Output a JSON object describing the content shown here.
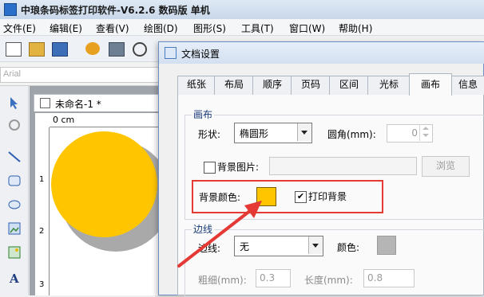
{
  "app": {
    "title": "中琅条码标签打印软件-V6.2.6 数码版 单机",
    "menu": [
      "文件(E)",
      "编辑(E)",
      "查看(V)",
      "绘图(D)",
      "图形(S)",
      "工具(T)",
      "窗口(W)",
      "帮助(H)"
    ],
    "font_name": "Arial",
    "document_tab": "未命名-1 *",
    "ruler_label": "0 cm",
    "vruler_numbers": [
      "1",
      "2",
      "3"
    ]
  },
  "dialog": {
    "title": "文档设置",
    "tabs": [
      "纸张",
      "布局",
      "顺序",
      "页码",
      "区间",
      "光标",
      "画布",
      "信息"
    ],
    "active_tab": "画布",
    "canvas_group": {
      "title": "画布",
      "shape_label": "形状:",
      "shape_value": "椭圆形",
      "corner_label": "圆角(mm):",
      "corner_value": "0",
      "bg_image_label": "背景图片:",
      "browse_label": "浏览",
      "bg_color_label": "背景颜色:",
      "bg_color": "#ffc600",
      "print_bg_label": "打印背景",
      "print_bg_checked": true
    },
    "border_group": {
      "title": "边线",
      "border_label": "边线:",
      "border_value": "无",
      "color_label": "颜色:",
      "border_color": "#b5b5b5",
      "thickness_label": "粗细(mm):",
      "thickness_value": "0.3",
      "length_label": "长度(mm):",
      "length_value": "0.8"
    }
  },
  "colors": {
    "accent_highlight": "#e53935",
    "label_fill": "#ffc600"
  }
}
